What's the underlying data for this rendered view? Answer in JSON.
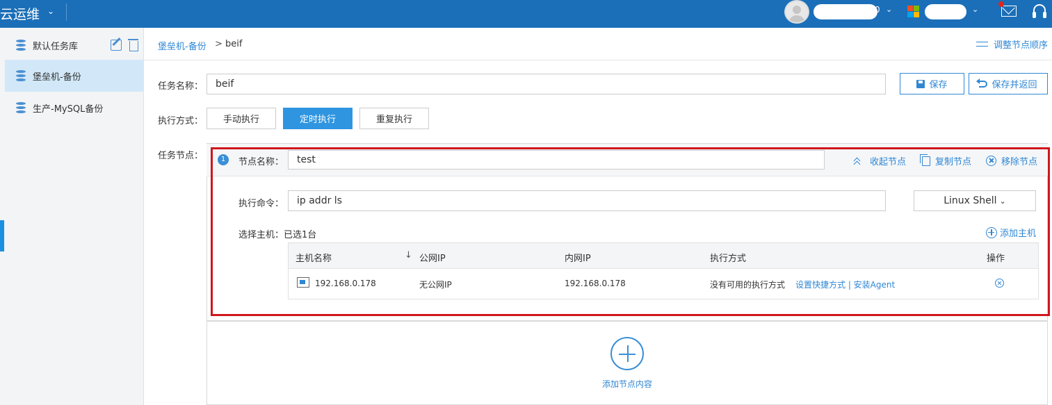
{
  "header": {
    "brand": "云运维",
    "user_suffix": "0",
    "caret": "⌄"
  },
  "sidebar": {
    "items": [
      {
        "label": "默认任务库"
      },
      {
        "label": "堡垒机-备份"
      },
      {
        "label": "生产-MySQL备份"
      }
    ]
  },
  "breadcrumb": {
    "parent": "堡垒机-备份",
    "separator": ">",
    "current": "beif",
    "reorder_label": "调整节点顺序"
  },
  "form": {
    "task_name_label": "任务名称：",
    "task_name_value": "beif",
    "save_label": "保存",
    "save_return_label": "保存并返回",
    "exec_mode_label": "执行方式：",
    "exec_modes": [
      "手动执行",
      "定时执行",
      "重复执行"
    ],
    "task_nodes_label": "任务节点："
  },
  "node": {
    "index": "1",
    "name_label": "节点名称：",
    "name_value": "test",
    "collapse_label": "收起节点",
    "copy_label": "复制节点",
    "remove_label": "移除节点",
    "command_label": "执行命令：",
    "command_value": "ip addr ls",
    "shell_select": "Linux Shell",
    "select_host_label": "选择主机：已选1台",
    "add_host_label": "添加主机"
  },
  "host_table": {
    "columns": [
      "主机名称",
      "公网IP",
      "内网IP",
      "执行方式",
      "操作"
    ],
    "sort_arrow": "↓",
    "rows": [
      {
        "host": "192.168.0.178",
        "public_ip": "无公网IP",
        "private_ip": "192.168.0.178",
        "exec": "没有可用的执行方式",
        "links": "设置快捷方式 | 安装Agent"
      }
    ]
  },
  "add_node": {
    "label": "添加节点内容"
  }
}
